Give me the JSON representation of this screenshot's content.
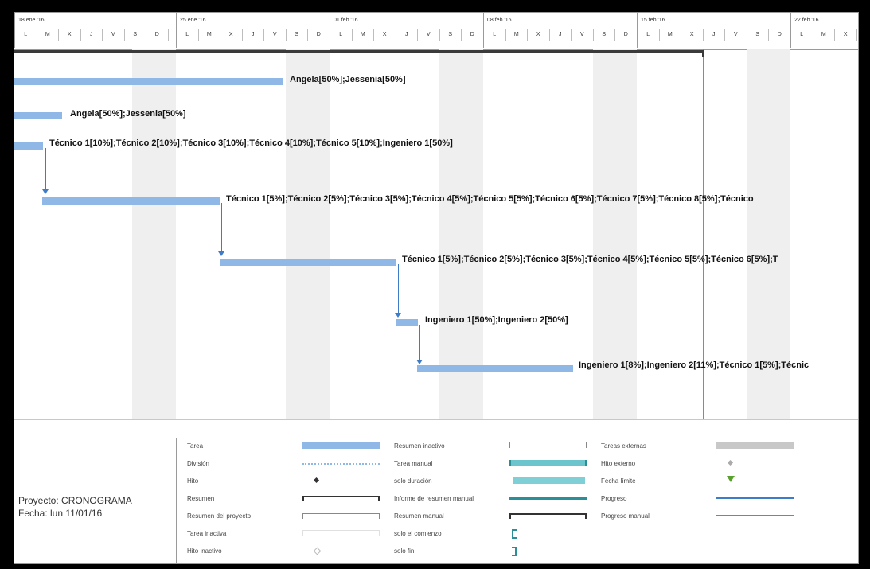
{
  "timescale": {
    "weeks": [
      {
        "label": "18 ene '16"
      },
      {
        "label": "25 ene '16"
      },
      {
        "label": "01 feb '16"
      },
      {
        "label": "08 feb '16"
      },
      {
        "label": "15 feb '16"
      },
      {
        "label": "22 feb '16"
      }
    ],
    "days": [
      "L",
      "M",
      "X",
      "J",
      "V",
      "S",
      "D"
    ]
  },
  "tasks": [
    {
      "resources": "Angela[50%];Jessenia[50%]"
    },
    {
      "resources": "Angela[50%];Jessenia[50%]"
    },
    {
      "resources": "Técnico 1[10%];Técnico 2[10%];Técnico 3[10%];Técnico 4[10%];Técnico 5[10%];Ingeniero 1[50%]"
    },
    {
      "resources": "Técnico 1[5%];Técnico 2[5%];Técnico 3[5%];Técnico 4[5%];Técnico 5[5%];Técnico 6[5%];Técnico 7[5%];Técnico 8[5%];Técnico"
    },
    {
      "resources": "Técnico 1[5%];Técnico 2[5%];Técnico 3[5%];Técnico 4[5%];Técnico 5[5%];Técnico 6[5%];T"
    },
    {
      "resources": "Ingeniero 1[50%];Ingeniero 2[50%]"
    },
    {
      "resources": "Ingeniero 1[8%];Ingeniero 2[11%];Técnico 1[5%];Técnic"
    }
  ],
  "legend": {
    "project": "Proyecto: CRONOGRAMA",
    "date": "Fecha: lun 11/01/16",
    "col1": [
      "Tarea",
      "División",
      "Hito",
      "Resumen",
      "Resumen del proyecto",
      "Tarea inactiva",
      "Hito inactivo"
    ],
    "col2": [
      "Resumen inactivo",
      "Tarea manual",
      "solo duración",
      "Informe de resumen manual",
      "Resumen manual",
      "solo el comienzo",
      "solo fin"
    ],
    "col3": [
      "Tareas externas",
      "Hito externo",
      "Fecha límite",
      "Progreso",
      "Progreso manual"
    ]
  },
  "colors": {
    "task_bar": "#8fb8e6",
    "link": "#3f7cc7",
    "manual": "#6cc5cc",
    "deadline": "#5aa02c",
    "external": "#c8c8c8"
  }
}
